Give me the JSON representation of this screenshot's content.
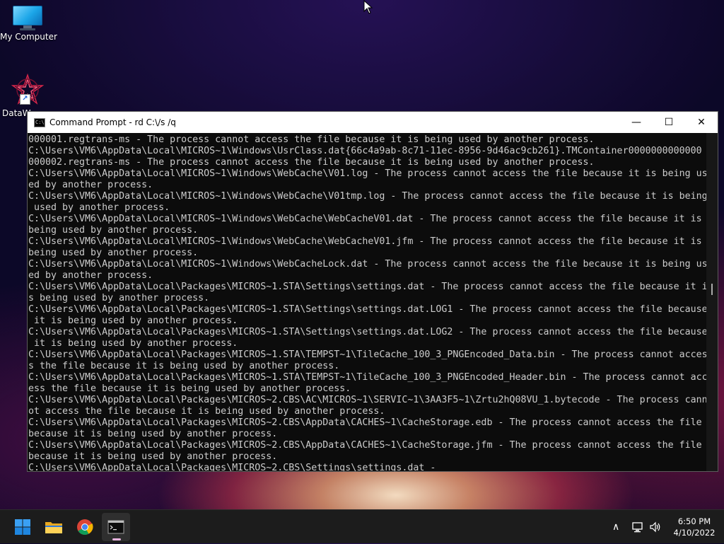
{
  "desktop": {
    "icons": [
      {
        "label": "My Computer"
      },
      {
        "label": "DataW"
      }
    ]
  },
  "window": {
    "title": "Command Prompt - rd  C:\\/s /q",
    "controls": {
      "minimize": "—",
      "maximize": "☐",
      "close": "✕"
    },
    "console_lines": [
      "000001.regtrans-ms - The process cannot access the file because it is being used by another process.",
      "C:\\Users\\VM6\\AppData\\Local\\MICROS~1\\Windows\\UsrClass.dat{66c4a9ab-8c71-11ec-8956-9d46ac9cb261}.TMContainer0000000000000",
      "000002.regtrans-ms - The process cannot access the file because it is being used by another process.",
      "C:\\Users\\VM6\\AppData\\Local\\MICROS~1\\Windows\\WebCache\\V01.log - The process cannot access the file because it is being us",
      "ed by another process.",
      "C:\\Users\\VM6\\AppData\\Local\\MICROS~1\\Windows\\WebCache\\V01tmp.log - The process cannot access the file because it is being",
      " used by another process.",
      "C:\\Users\\VM6\\AppData\\Local\\MICROS~1\\Windows\\WebCache\\WebCacheV01.dat - The process cannot access the file because it is",
      "being used by another process.",
      "C:\\Users\\VM6\\AppData\\Local\\MICROS~1\\Windows\\WebCache\\WebCacheV01.jfm - The process cannot access the file because it is",
      "being used by another process.",
      "C:\\Users\\VM6\\AppData\\Local\\MICROS~1\\Windows\\WebCacheLock.dat - The process cannot access the file because it is being us",
      "ed by another process.",
      "C:\\Users\\VM6\\AppData\\Local\\Packages\\MICROS~1.STA\\Settings\\settings.dat - The process cannot access the file because it i",
      "s being used by another process.",
      "C:\\Users\\VM6\\AppData\\Local\\Packages\\MICROS~1.STA\\Settings\\settings.dat.LOG1 - The process cannot access the file because",
      " it is being used by another process.",
      "C:\\Users\\VM6\\AppData\\Local\\Packages\\MICROS~1.STA\\Settings\\settings.dat.LOG2 - The process cannot access the file because",
      " it is being used by another process.",
      "C:\\Users\\VM6\\AppData\\Local\\Packages\\MICROS~1.STA\\TEMPST~1\\TileCache_100_3_PNGEncoded_Data.bin - The process cannot acces",
      "s the file because it is being used by another process.",
      "C:\\Users\\VM6\\AppData\\Local\\Packages\\MICROS~1.STA\\TEMPST~1\\TileCache_100_3_PNGEncoded_Header.bin - The process cannot acc",
      "ess the file because it is being used by another process.",
      "C:\\Users\\VM6\\AppData\\Local\\Packages\\MICROS~2.CBS\\AC\\MICROS~1\\SERVIC~1\\3AA3F5~1\\Zrtu2hQ08VU_1.bytecode - The process cann",
      "ot access the file because it is being used by another process.",
      "C:\\Users\\VM6\\AppData\\Local\\Packages\\MICROS~2.CBS\\AppData\\CACHES~1\\CacheStorage.edb - The process cannot access the file",
      "because it is being used by another process.",
      "C:\\Users\\VM6\\AppData\\Local\\Packages\\MICROS~2.CBS\\AppData\\CACHES~1\\CacheStorage.jfm - The process cannot access the file",
      "because it is being used by another process.",
      "C:\\Users\\VM6\\AppData\\Local\\Packages\\MICROS~2.CBS\\Settings\\settings.dat -"
    ]
  },
  "taskbar": {
    "apps": [
      "start-icon",
      "file-explorer-icon",
      "chrome-icon",
      "command-prompt-icon"
    ],
    "tray": {
      "chevron": "∧"
    },
    "clock": {
      "time": "6:50 PM",
      "date": "4/10/2022"
    }
  },
  "colors": {
    "console_bg": "#0c0c0c",
    "console_text": "#cccccc",
    "taskbar_bg": "#1c1c1c",
    "active_indicator": "#e8b3e0"
  }
}
